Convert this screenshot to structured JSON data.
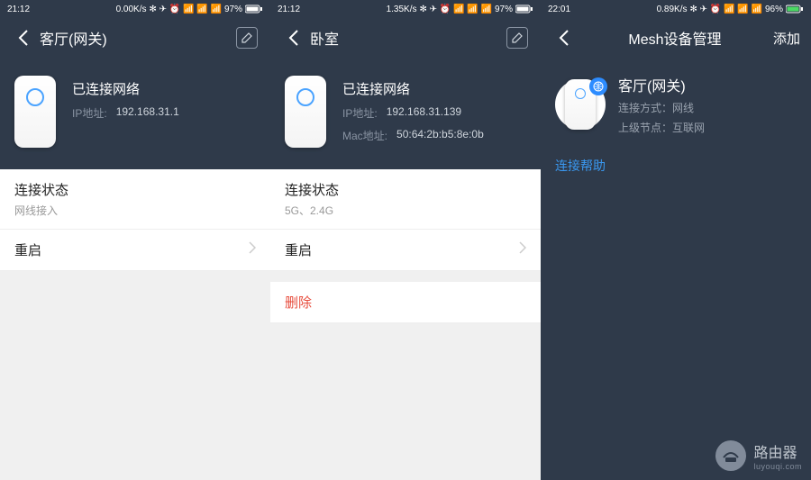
{
  "panels": [
    {
      "status": {
        "time": "21:12",
        "net": "0.00K/s",
        "battery": "97%"
      },
      "nav": {
        "title": "客厅(网关)"
      },
      "hero": {
        "status": "已连接网络",
        "rows": [
          {
            "label": "IP地址:",
            "value": "192.168.31.1"
          }
        ]
      },
      "list": {
        "conn_title": "连接状态",
        "conn_sub": "网线接入",
        "restart": "重启"
      }
    },
    {
      "status": {
        "time": "21:12",
        "net": "1.35K/s",
        "battery": "97%"
      },
      "nav": {
        "title": "卧室"
      },
      "hero": {
        "status": "已连接网络",
        "rows": [
          {
            "label": "IP地址:",
            "value": "192.168.31.139"
          },
          {
            "label": "Mac地址:",
            "value": "50:64:2b:b5:8e:0b"
          }
        ]
      },
      "list": {
        "conn_title": "连接状态",
        "conn_sub": "5G、2.4G",
        "restart": "重启",
        "delete": "删除"
      }
    },
    {
      "status": {
        "time": "22:01",
        "net": "0.89K/s",
        "battery": "96%"
      },
      "nav": {
        "title": "Mesh设备管理",
        "action": "添加"
      },
      "mesh": {
        "name": "客厅(网关)",
        "mode": "连接方式：网线",
        "upstream": "上级节点：互联网"
      },
      "help": "连接帮助"
    }
  ],
  "watermark": {
    "cn": "路由器",
    "en": "luyouqi.com"
  },
  "icons": {
    "status_glyphs": "✻ ✈ ⏰ 📶 📶 📶"
  }
}
